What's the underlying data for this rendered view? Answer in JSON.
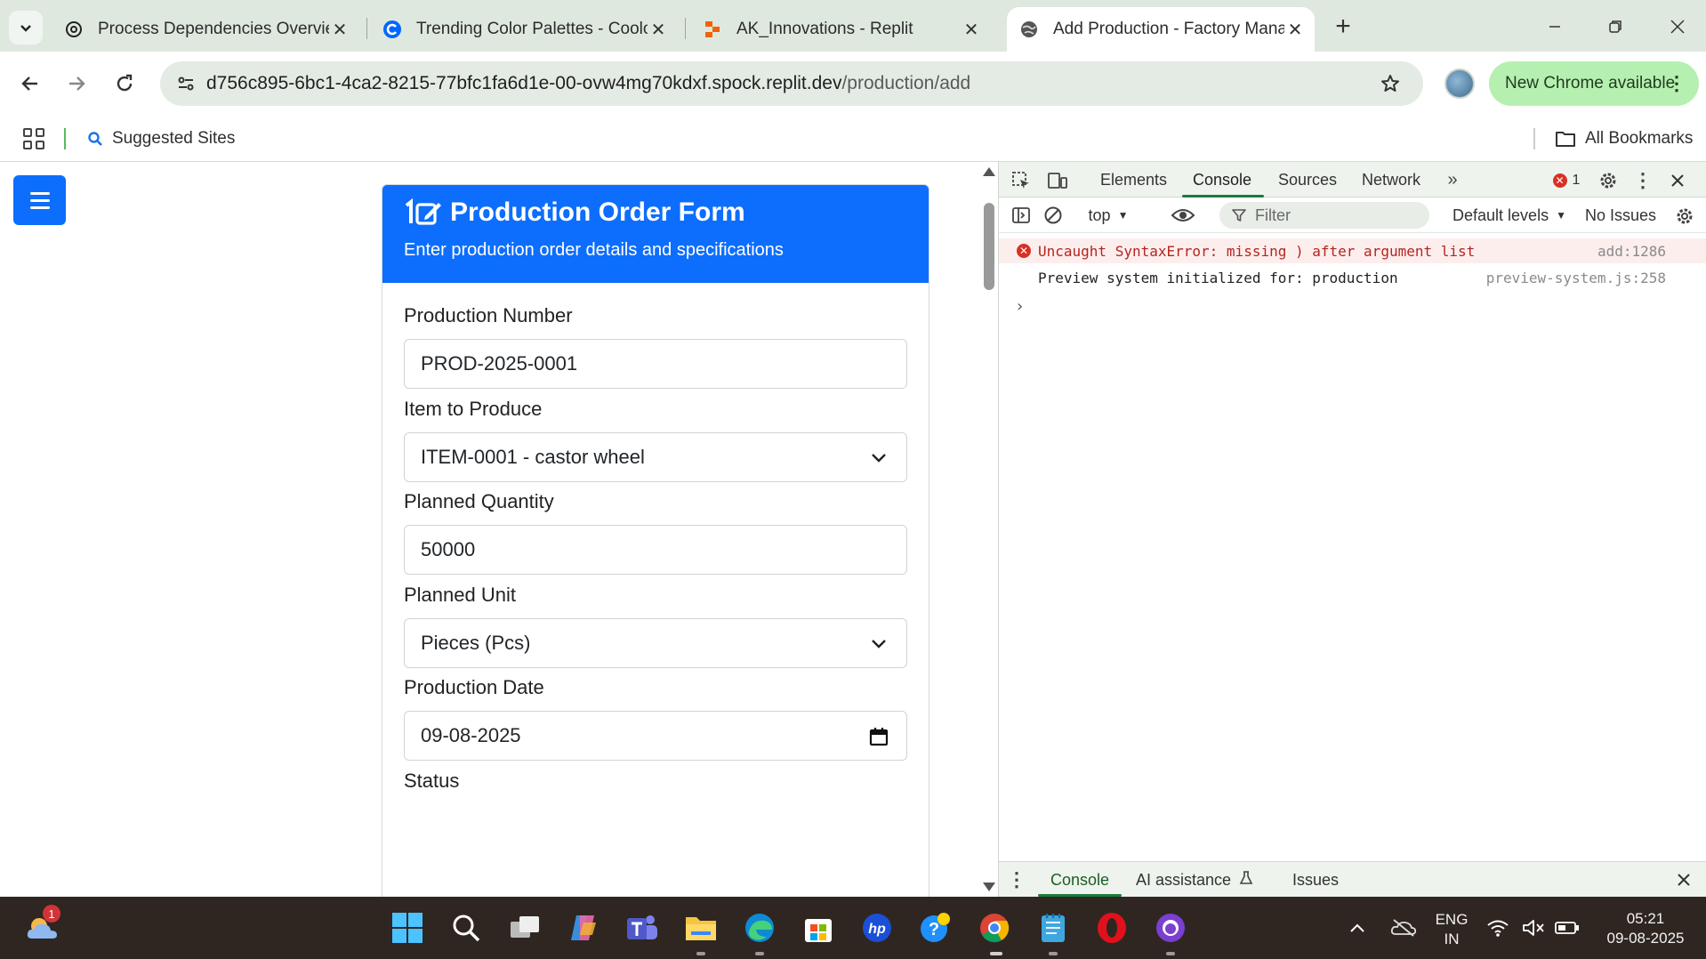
{
  "browser": {
    "tabs": [
      {
        "title": "Process Dependencies Overview",
        "active": false,
        "favicon": "openai-icon"
      },
      {
        "title": "Trending Color Palettes - Coolors",
        "active": false,
        "favicon": "coolors-icon"
      },
      {
        "title": "AK_Innovations - Replit",
        "active": false,
        "favicon": "replit-icon"
      },
      {
        "title": "Add Production - Factory Management",
        "active": true,
        "favicon": "globe-icon"
      }
    ],
    "url_host": "d756c895-6bc1-4ca2-8215-77bfc1fa6d1e-00-ovw4mg70kdxf.spock.replit.dev",
    "url_path": "/production/add",
    "update_label": "New Chrome available",
    "bookmarks": {
      "suggested": "Suggested Sites",
      "all": "All Bookmarks"
    }
  },
  "page": {
    "card_title": "Production Order Form",
    "card_subtitle": "Enter production order details and specifications",
    "fields": {
      "production_number_label": "Production Number",
      "production_number_value": "PROD-2025-0001",
      "item_label": "Item to Produce",
      "item_value": "ITEM-0001 - castor wheel",
      "planned_qty_label": "Planned Quantity",
      "planned_qty_value": "50000",
      "planned_unit_label": "Planned Unit",
      "planned_unit_value": "Pieces (Pcs)",
      "production_date_label": "Production Date",
      "production_date_value": "09-08-2025",
      "status_label": "Status"
    }
  },
  "devtools": {
    "tabs": [
      "Elements",
      "Console",
      "Sources",
      "Network"
    ],
    "active_tab": "Console",
    "error_count": "1",
    "context": "top",
    "filter_placeholder": "Filter",
    "levels": "Default levels",
    "issues": "No Issues",
    "messages": [
      {
        "type": "error",
        "text": "Uncaught SyntaxError: missing ) after argument list",
        "source": "add:1286"
      },
      {
        "type": "log",
        "text": "Preview system initialized for: production",
        "source": "preview-system.js:258"
      }
    ],
    "drawer_tabs": [
      "Console",
      "AI assistance",
      "Issues"
    ]
  },
  "taskbar": {
    "weather_badge": "1",
    "lang_top": "ENG",
    "lang_bottom": "IN",
    "time": "05:21",
    "date": "09-08-2025"
  },
  "colors": {
    "primary": "#0d6efd",
    "chrome_frame": "#dfe8df",
    "update_pill": "#b6f0b0",
    "error_bg": "#fdeeee"
  }
}
